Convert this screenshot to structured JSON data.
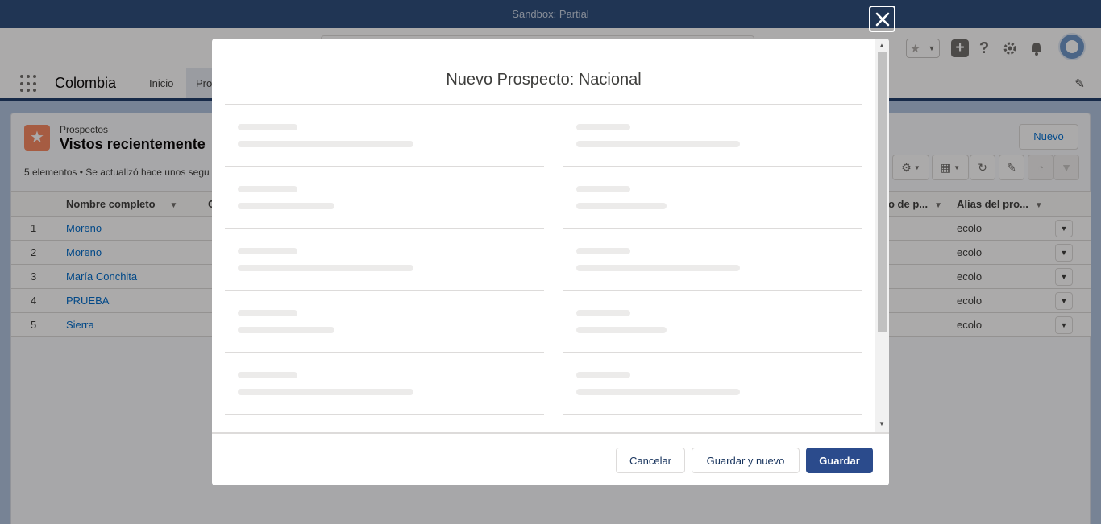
{
  "sandbox_banner": "Sandbox: Partial",
  "app": {
    "name": "Colombia"
  },
  "nav_tabs": [
    {
      "label": "Inicio"
    },
    {
      "label": "Pro"
    }
  ],
  "list_view": {
    "object_label": "Prospectos",
    "title": "Vistos recientemente",
    "meta": "5 elementos • Se actualizó hace unos segu",
    "new_button": "Nuevo",
    "columns": {
      "name": "Nombre completo",
      "col3": "C",
      "col_partial": "o de p...",
      "alias": "Alias del pro..."
    },
    "rows": [
      {
        "num": "1",
        "name": "Moreno",
        "alias": "ecolo"
      },
      {
        "num": "2",
        "name": "Moreno",
        "alias": "ecolo"
      },
      {
        "num": "3",
        "name": "María Conchita",
        "alias": "ecolo"
      },
      {
        "num": "4",
        "name": "PRUEBA",
        "alias": "ecolo"
      },
      {
        "num": "5",
        "name": "Sierra",
        "alias": "ecolo"
      }
    ]
  },
  "modal": {
    "title": "Nuevo Prospecto: Nacional",
    "buttons": {
      "cancel": "Cancelar",
      "save_new": "Guardar y nuevo",
      "save": "Guardar"
    }
  },
  "icons": {
    "close": "close-icon",
    "favorite": "star-icon",
    "add": "plus-icon",
    "help": "question-icon",
    "setup": "gear-icon",
    "notifications": "bell-icon"
  },
  "colors": {
    "brand_button": "#2b4b8c",
    "sandbox_bar": "#2d4e7d",
    "link": "#006dcc",
    "object_icon": "#f88962"
  }
}
